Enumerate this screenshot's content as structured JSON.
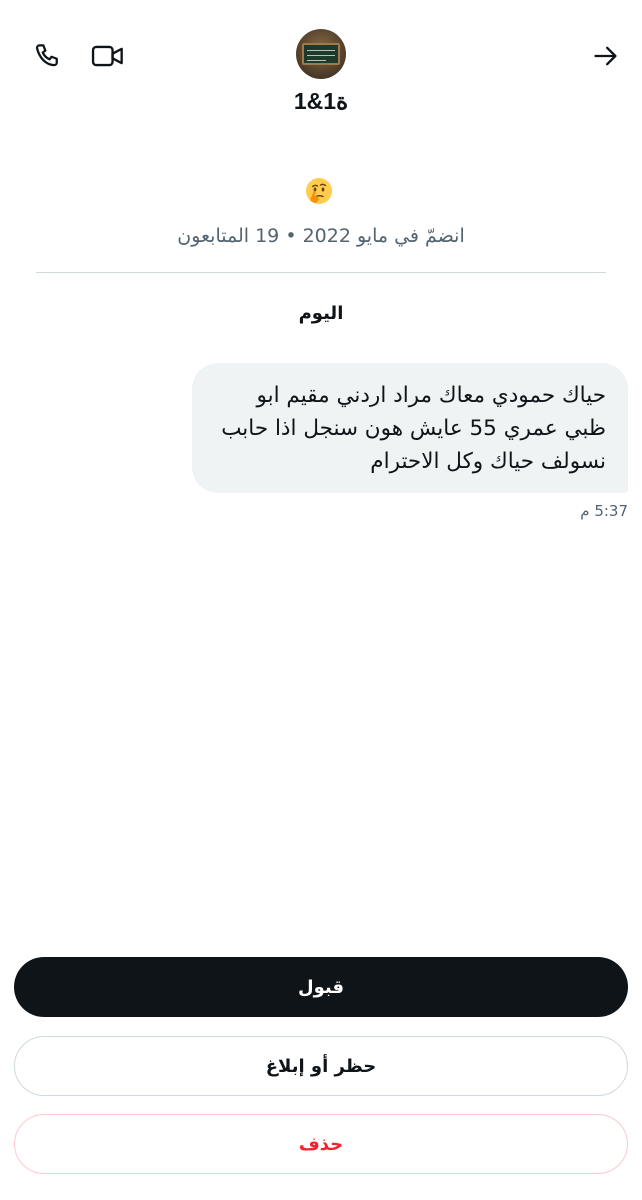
{
  "header": {
    "display_name": "1&1ة",
    "phone_icon": "phone-icon",
    "video_icon": "video-camera-icon",
    "back_icon": "arrow-right-icon"
  },
  "profile": {
    "bio_emoji": "thinking-face-emoji",
    "meta": "انضمّ في مايو 2022 • 19 المتابعون"
  },
  "conversation": {
    "date_separator": "اليوم",
    "message": {
      "text": "حياك حمودي معاك مراد اردني مقيم ابو ظبي عمري 55 عايش هون سنجل اذا حابب نسولف حياك وكل الاحترام",
      "time": "5:37 م"
    }
  },
  "actions": {
    "accept": "قبول",
    "block_report": "حظر أو إبلاغ",
    "delete": "حذف"
  },
  "colors": {
    "primary_text": "#0f1419",
    "secondary_text": "#536471",
    "bubble_bg": "#eff3f4",
    "danger": "#f4212e"
  }
}
